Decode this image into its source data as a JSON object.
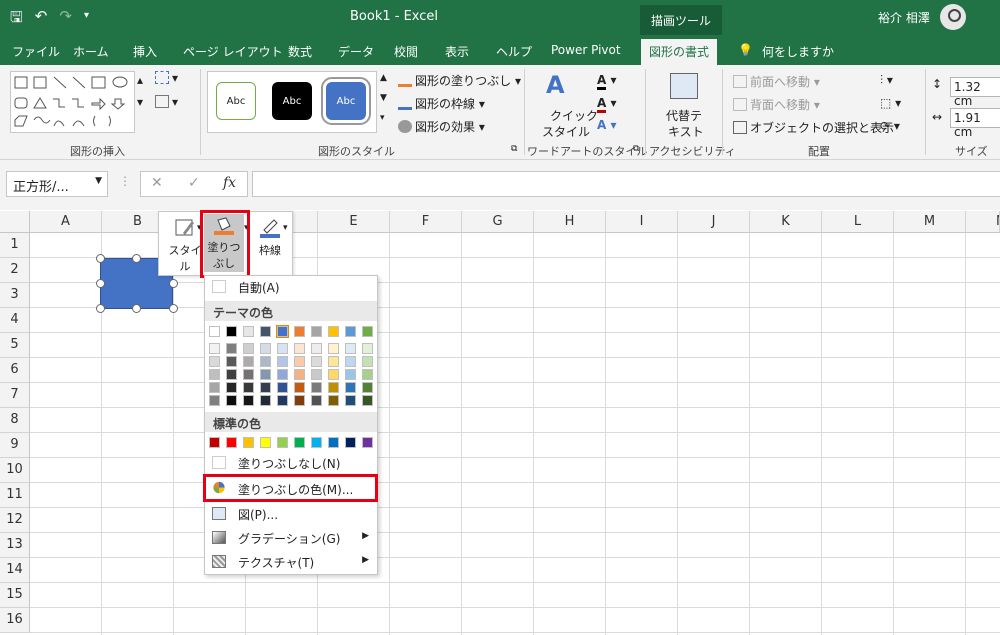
{
  "window": {
    "title": "Book1  -  Excel",
    "context_tool": "描画ツール",
    "user": "裕介 相澤"
  },
  "tabs": [
    "ファイル",
    "ホーム",
    "挿入",
    "ページ レイアウト",
    "数式",
    "データ",
    "校閲",
    "表示",
    "ヘルプ",
    "Power Pivot",
    "図形の書式",
    "何をしますか"
  ],
  "ribbon": {
    "groups": {
      "insert_shapes": "図形の挿入",
      "shape_styles": "図形のスタイル",
      "wordart_styles": "ワードアートのスタイル",
      "accessibility": "アクセシビリティ",
      "arrange": "配置",
      "size": "サイズ"
    },
    "style_preview": "Abc",
    "shape_fill": "図形の塗りつぶし",
    "shape_outline": "図形の枠線",
    "shape_effects": "図形の効果",
    "quick_style_1": "クイック",
    "quick_style_2": "スタイル",
    "alt_text_1": "代替テ",
    "alt_text_2": "キスト",
    "bring_forward": "前面へ移動",
    "send_backward": "背面へ移動",
    "selection_pane": "オブジェクトの選択と表示",
    "height": "1.32 cm",
    "width": "1.91 cm"
  },
  "formula_bar": {
    "name_box": "正方形/...",
    "cancel": "✕",
    "enter": "✓",
    "fx": "fx"
  },
  "columns": [
    "A",
    "B",
    "C",
    "D",
    "E",
    "F",
    "G",
    "H",
    "I",
    "J",
    "K",
    "L",
    "M",
    "N"
  ],
  "rows": [
    "1",
    "2",
    "3",
    "4",
    "5",
    "6",
    "7",
    "8",
    "9",
    "10",
    "11",
    "12",
    "13",
    "14",
    "15",
    "16"
  ],
  "mini_toolbar": {
    "style": "スタイル",
    "fill_1": "塗りつ",
    "fill_2": "ぶし",
    "outline": "枠線"
  },
  "fill_menu": {
    "automatic": "自動(A)",
    "theme_colors": "テーマの色",
    "standard_colors": "標準の色",
    "no_fill": "塗りつぶしなし(N)",
    "more_colors": "塗りつぶしの色(M)...",
    "picture": "図(P)...",
    "gradient": "グラデーション(G)",
    "texture": "テクスチャ(T)",
    "theme_top": [
      "#ffffff",
      "#000000",
      "#e7e6e6",
      "#44546a",
      "#4472c4",
      "#ed7d31",
      "#a5a5a5",
      "#ffc000",
      "#5b9bd5",
      "#70ad47"
    ],
    "theme_shades": [
      [
        "#f2f2f2",
        "#d9d9d9",
        "#bfbfbf",
        "#a6a6a6",
        "#808080"
      ],
      [
        "#7f7f7f",
        "#595959",
        "#404040",
        "#262626",
        "#0d0d0d"
      ],
      [
        "#d0cece",
        "#aeaaaa",
        "#757171",
        "#3b3838",
        "#181717"
      ],
      [
        "#d6dce4",
        "#adb9ca",
        "#8497b0",
        "#333f4f",
        "#222a35"
      ],
      [
        "#d9e2f3",
        "#b4c6e7",
        "#8eaadb",
        "#2f5496",
        "#1f3864"
      ],
      [
        "#fbe5d5",
        "#f7cbac",
        "#f4b183",
        "#c55a11",
        "#833c0b"
      ],
      [
        "#ededed",
        "#dbdbdb",
        "#c9c9c9",
        "#7b7b7b",
        "#525252"
      ],
      [
        "#fff2cc",
        "#ffe598",
        "#ffd965",
        "#bf9000",
        "#7f6000"
      ],
      [
        "#deebf6",
        "#bdd7ee",
        "#9dc3e6",
        "#2e75b5",
        "#1f4e79"
      ],
      [
        "#e2efd9",
        "#c5e0b3",
        "#a8d08d",
        "#538135",
        "#375623"
      ]
    ],
    "standard": [
      "#c00000",
      "#ff0000",
      "#ffc000",
      "#ffff00",
      "#92d050",
      "#00b050",
      "#00b0f0",
      "#0070c0",
      "#002060",
      "#7030a0"
    ]
  },
  "colors": {
    "excel_green": "#217346",
    "shape_fill": "#4472c4",
    "highlight": "#e60012"
  }
}
